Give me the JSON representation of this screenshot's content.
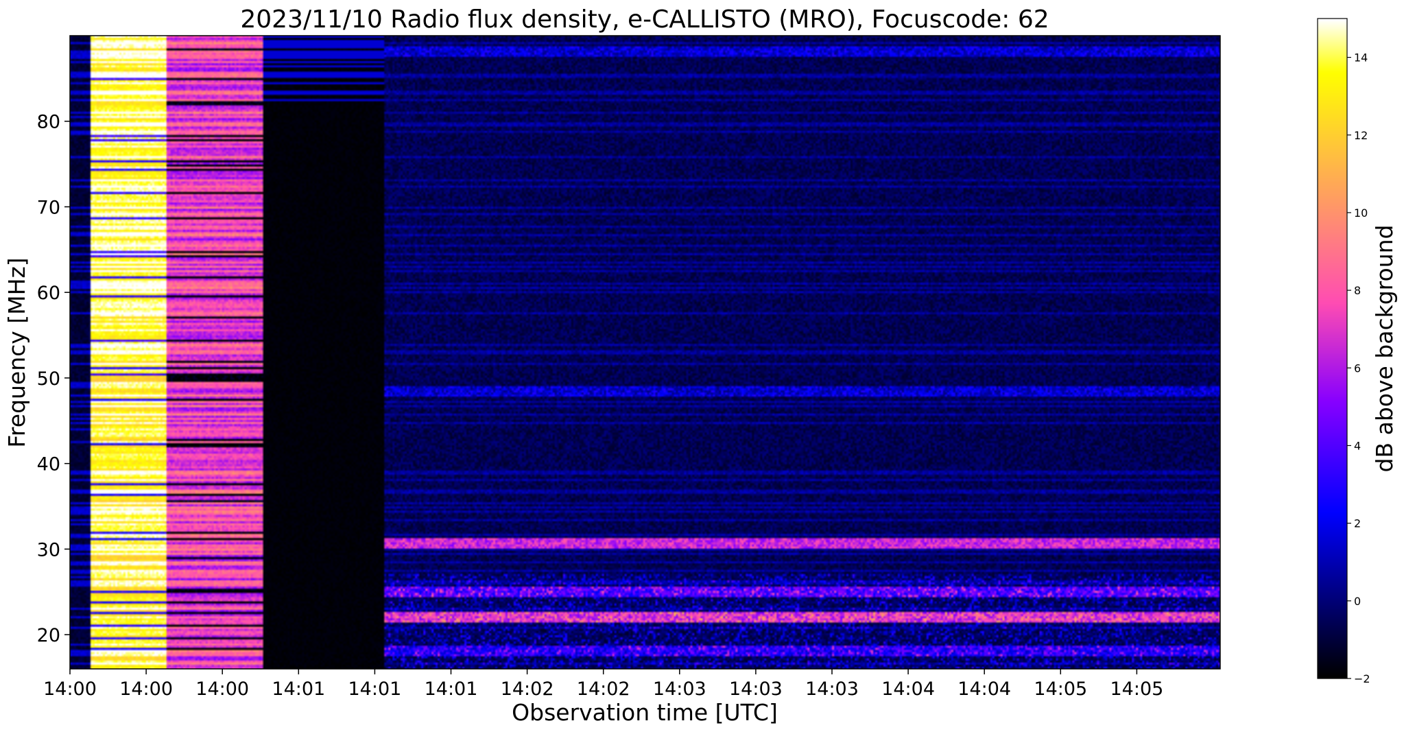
{
  "chart_data": {
    "type": "heatmap",
    "title": "2023/11/10  Radio flux density, e-CALLISTO (MRO), Focuscode: 62",
    "xlabel": "Observation time [UTC]",
    "ylabel": "Frequency [MHz]",
    "colorbar_label": "dB above background",
    "colormap": "gnuplot2",
    "x_ticks": [
      "14:00",
      "14:00",
      "14:00",
      "14:01",
      "14:01",
      "14:01",
      "14:02",
      "14:02",
      "14:03",
      "14:03",
      "14:03",
      "14:04",
      "14:04",
      "14:05",
      "14:05"
    ],
    "y_ticks": [
      20,
      30,
      40,
      50,
      60,
      70,
      80
    ],
    "ylim": [
      16,
      90
    ],
    "colorbar_ticks": [
      -2,
      0,
      2,
      4,
      6,
      8,
      10,
      12,
      14
    ],
    "clim": [
      -2,
      15
    ],
    "regions": [
      {
        "time_fraction": [
          0.0,
          0.017
        ],
        "level_db": 0,
        "description": "background with noise"
      },
      {
        "time_fraction": [
          0.017,
          0.084
        ],
        "level_db": 14,
        "description": "saturated interference block"
      },
      {
        "time_fraction": [
          0.084,
          0.168
        ],
        "level_db": 7,
        "description": "strong interference block"
      },
      {
        "time_fraction": [
          0.168,
          0.273
        ],
        "level_db": -2,
        "description": "no data / background"
      },
      {
        "time_fraction": [
          0.273,
          1.0
        ],
        "level_db": 0.5,
        "description": "normal spectrogram with RFI lines"
      }
    ],
    "emission_bands_mhz": [
      {
        "freq": 30.7,
        "level_db": 8
      },
      {
        "freq": 48.5,
        "level_db": 3
      },
      {
        "freq": 88.2,
        "level_db": 3
      },
      {
        "freq": 25,
        "level_db": 5
      },
      {
        "freq": 22,
        "level_db": 8
      },
      {
        "freq": 18,
        "level_db": 4
      }
    ]
  }
}
